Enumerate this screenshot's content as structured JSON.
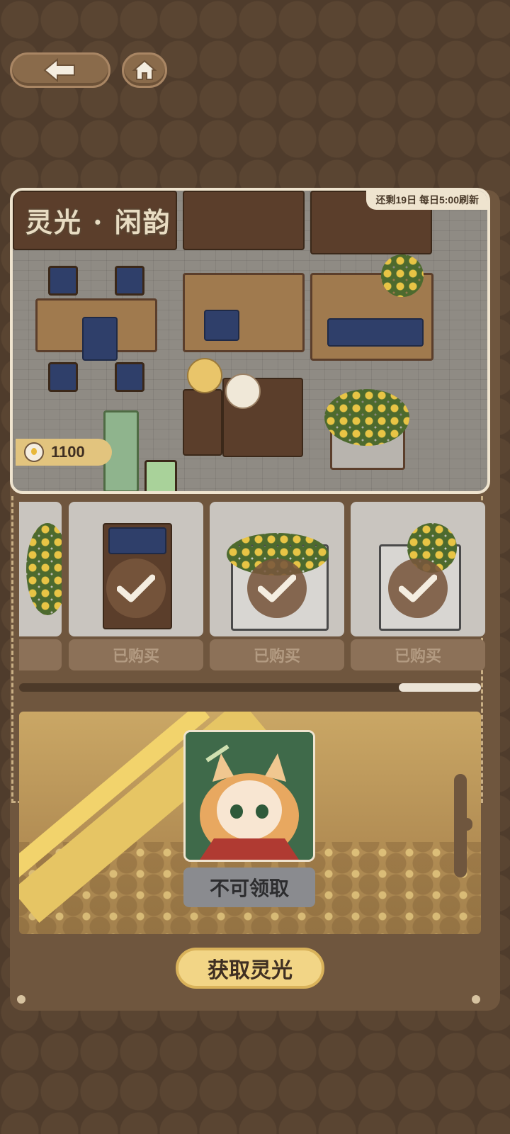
{
  "nav": {
    "back_icon": "arrow-left-icon",
    "home_icon": "home-icon"
  },
  "scene": {
    "title": "灵光 · 闲韵",
    "refresh_text": "还剩19日 每日5:00刷新",
    "currency_icon": "light-bulb-icon",
    "currency_value": "1100"
  },
  "shop": {
    "items": [
      {
        "label": "已购买",
        "purchased": true
      },
      {
        "label": "已购买",
        "purchased": true
      },
      {
        "label": "已购买",
        "purchased": true
      }
    ],
    "scroll_fraction": 0.82
  },
  "reward": {
    "claim_label": "不可领取"
  },
  "actions": {
    "get_light_label": "获取灵光"
  },
  "colors": {
    "background": "#4f3c2c",
    "panel": "#6f563e",
    "gold": "#f2d586",
    "disabled": "#8a8b8f"
  }
}
